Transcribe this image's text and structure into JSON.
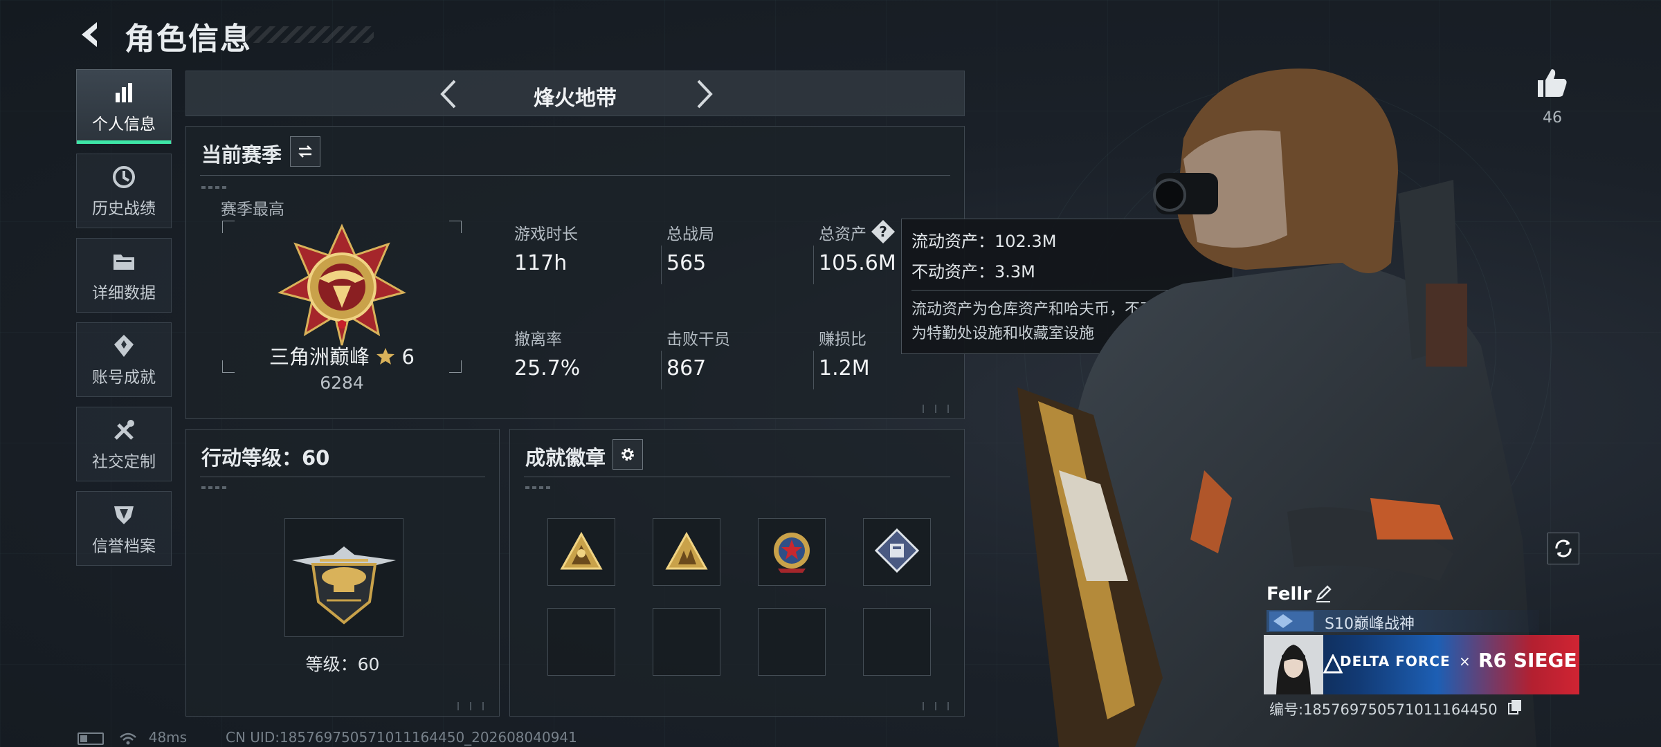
{
  "header": {
    "title": "角色信息",
    "back_icon": "back-arrow-icon"
  },
  "sidebar": {
    "items": [
      {
        "label": "个人信息",
        "icon": "bar-chart-icon",
        "active": true
      },
      {
        "label": "历史战绩",
        "icon": "clock-icon",
        "active": false
      },
      {
        "label": "详细数据",
        "icon": "folder-icon",
        "active": false
      },
      {
        "label": "账号成就",
        "icon": "achievement-icon",
        "active": false
      },
      {
        "label": "社交定制",
        "icon": "tools-icon",
        "active": false
      },
      {
        "label": "信誉档案",
        "icon": "shield-icon",
        "active": false
      }
    ]
  },
  "mode": {
    "name": "烽火地带"
  },
  "season": {
    "title": "当前赛季",
    "best_label": "赛季最高",
    "rank_name": "三角洲巅峰",
    "rank_stars": "6",
    "rank_score": "6284",
    "stats": [
      {
        "label": "游戏时长",
        "value": "117h"
      },
      {
        "label": "总战局",
        "value": "565"
      },
      {
        "label": "总资产",
        "value": "105.6M"
      },
      {
        "label": "撤离率",
        "value": "25.7%"
      },
      {
        "label": "击败干员",
        "value": "867"
      },
      {
        "label": "赚损比",
        "value": "1.2M"
      }
    ]
  },
  "tooltip": {
    "liquid": "流动资产：102.3M",
    "fixed": "不动资产：3.3M",
    "desc_line1": "流动资产为仓库资产和哈夫币，不动资产",
    "desc_line2": "为特勤处设施和收藏室设施"
  },
  "level": {
    "title": "行动等级：60",
    "label": "等级：60"
  },
  "badges": {
    "title": "成就徽章",
    "filled_count": 4,
    "empty_count": 4
  },
  "player": {
    "like_count": "46",
    "name": "Fellr",
    "title": "S10巅峰战神",
    "card_brand1": "DELTA FORCE",
    "card_x": "×",
    "card_brand2": "R6 SIEGE",
    "id": "编号:185769750571011164450"
  },
  "status": {
    "ping": "48ms",
    "uid": "CN UID:185769750571011164450_202608040941"
  },
  "colors": {
    "accent": "#3ee6a7",
    "panel_bg": "#1c2228",
    "gold": "#c9a24a"
  }
}
